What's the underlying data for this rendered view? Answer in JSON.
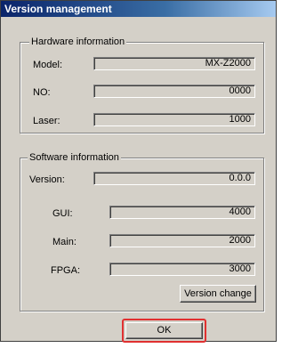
{
  "window": {
    "title": "Version management"
  },
  "hardware": {
    "group_label": "Hardware information",
    "model_label": "Model:",
    "model_value": "MX-Z2000",
    "no_label": "NO:",
    "no_value": "0000",
    "laser_label": "Laser:",
    "laser_value": "1000"
  },
  "software": {
    "group_label": "Software information",
    "version_label": "Version:",
    "version_value": "0.0.0",
    "gui_label": "GUI:",
    "gui_value": "4000",
    "main_label": "Main:",
    "main_value": "2000",
    "fpga_label": "FPGA:",
    "fpga_value": "3000",
    "version_change_label": "Version change"
  },
  "buttons": {
    "ok_label": "OK"
  },
  "colors": {
    "highlight": "#e03030",
    "title_bar": "#0a246a",
    "dialog_bg": "#d4d0c8"
  }
}
